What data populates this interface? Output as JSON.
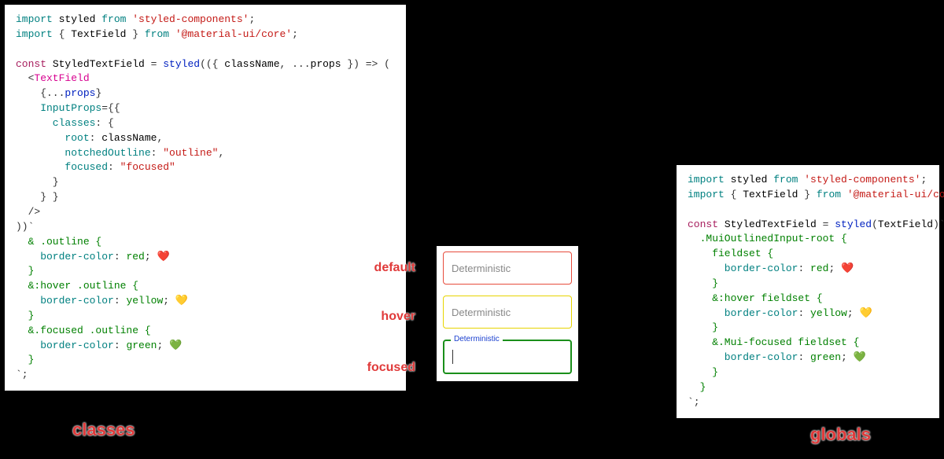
{
  "panel_left": {
    "lines": [
      [
        [
          "kw",
          "import "
        ],
        [
          "id",
          "styled "
        ],
        [
          "kw",
          "from "
        ],
        [
          "str",
          "'styled-components'"
        ],
        [
          "pun",
          ";"
        ]
      ],
      [
        [
          "kw",
          "import "
        ],
        [
          "pun",
          "{ "
        ],
        [
          "id",
          "TextField "
        ],
        [
          "pun",
          "} "
        ],
        [
          "kw",
          "from "
        ],
        [
          "str",
          "'@material-ui/core'"
        ],
        [
          "pun",
          ";"
        ]
      ],
      [
        [
          "",
          ""
        ]
      ],
      [
        [
          "const",
          "const "
        ],
        [
          "id",
          "StyledTextField "
        ],
        [
          "pun",
          "= "
        ],
        [
          "def",
          "styled"
        ],
        [
          "pun",
          "(({ "
        ],
        [
          "id",
          "className"
        ],
        [
          "pun",
          ", ..."
        ],
        [
          "id",
          "props"
        ],
        [
          "pun",
          " }) "
        ],
        [
          "pun",
          "=>"
        ],
        [
          "pun",
          " ("
        ]
      ],
      [
        [
          "pun",
          "  <"
        ],
        [
          "tag",
          "TextField"
        ]
      ],
      [
        [
          "pun",
          "    {..."
        ],
        [
          "prop",
          "props"
        ],
        [
          "pun",
          "}"
        ]
      ],
      [
        [
          "attr",
          "    InputProps"
        ],
        [
          "pun",
          "={{"
        ]
      ],
      [
        [
          "key",
          "      classes"
        ],
        [
          "pun",
          ": {"
        ]
      ],
      [
        [
          "key",
          "        root"
        ],
        [
          "pun",
          ": "
        ],
        [
          "id",
          "className"
        ],
        [
          "pun",
          ","
        ]
      ],
      [
        [
          "key",
          "        notchedOutline"
        ],
        [
          "pun",
          ": "
        ],
        [
          "str",
          "\"outline\""
        ],
        [
          "pun",
          ","
        ]
      ],
      [
        [
          "key",
          "        focused"
        ],
        [
          "pun",
          ": "
        ],
        [
          "str",
          "\"focused\""
        ]
      ],
      [
        [
          "pun",
          "      }"
        ]
      ],
      [
        [
          "pun",
          "    } }"
        ]
      ],
      [
        [
          "pun",
          "  />"
        ]
      ],
      [
        [
          "pun",
          "))`"
        ]
      ],
      [
        [
          "sel",
          "  & .outline {"
        ]
      ],
      [
        [
          "cssprop",
          "    border-color"
        ],
        [
          "pun",
          ": "
        ],
        [
          "cssval",
          "red"
        ],
        [
          "pun",
          "; "
        ],
        [
          "emoji",
          "❤️"
        ]
      ],
      [
        [
          "sel",
          "  }"
        ]
      ],
      [
        [
          "sel",
          "  &:hover .outline {"
        ]
      ],
      [
        [
          "cssprop",
          "    border-color"
        ],
        [
          "pun",
          ": "
        ],
        [
          "cssval",
          "yellow"
        ],
        [
          "pun",
          "; "
        ],
        [
          "emoji",
          "💛"
        ]
      ],
      [
        [
          "sel",
          "  }"
        ]
      ],
      [
        [
          "sel",
          "  &.focused .outline {"
        ]
      ],
      [
        [
          "cssprop",
          "    border-color"
        ],
        [
          "pun",
          ": "
        ],
        [
          "cssval",
          "green"
        ],
        [
          "pun",
          "; "
        ],
        [
          "emoji",
          "💚"
        ]
      ],
      [
        [
          "sel",
          "  }"
        ]
      ],
      [
        [
          "pun",
          "`;"
        ]
      ]
    ]
  },
  "panel_right": {
    "lines": [
      [
        [
          "kw",
          "import "
        ],
        [
          "id",
          "styled "
        ],
        [
          "kw",
          "from "
        ],
        [
          "str",
          "'styled-components'"
        ],
        [
          "pun",
          ";"
        ]
      ],
      [
        [
          "kw",
          "import "
        ],
        [
          "pun",
          "{ "
        ],
        [
          "id",
          "TextField "
        ],
        [
          "pun",
          "} "
        ],
        [
          "kw",
          "from "
        ],
        [
          "str",
          "'@material-ui/core'"
        ],
        [
          "pun",
          ";"
        ]
      ],
      [
        [
          "",
          ""
        ]
      ],
      [
        [
          "const",
          "const "
        ],
        [
          "id",
          "StyledTextField "
        ],
        [
          "pun",
          "= "
        ],
        [
          "def",
          "styled"
        ],
        [
          "pun",
          "("
        ],
        [
          "id",
          "TextField"
        ],
        [
          "pun",
          ")`"
        ]
      ],
      [
        [
          "sel",
          "  .MuiOutlinedInput-root {"
        ]
      ],
      [
        [
          "sel",
          "    fieldset {"
        ]
      ],
      [
        [
          "cssprop",
          "      border-color"
        ],
        [
          "pun",
          ": "
        ],
        [
          "cssval",
          "red"
        ],
        [
          "pun",
          "; "
        ],
        [
          "emoji",
          "❤️"
        ]
      ],
      [
        [
          "sel",
          "    }"
        ]
      ],
      [
        [
          "sel",
          "    &:hover fieldset {"
        ]
      ],
      [
        [
          "cssprop",
          "      border-color"
        ],
        [
          "pun",
          ": "
        ],
        [
          "cssval",
          "yellow"
        ],
        [
          "pun",
          "; "
        ],
        [
          "emoji",
          "💛"
        ]
      ],
      [
        [
          "sel",
          "    }"
        ]
      ],
      [
        [
          "sel",
          "    &.Mui-focused fieldset {"
        ]
      ],
      [
        [
          "cssprop",
          "      border-color"
        ],
        [
          "pun",
          ": "
        ],
        [
          "cssval",
          "green"
        ],
        [
          "pun",
          "; "
        ],
        [
          "emoji",
          "💚"
        ]
      ],
      [
        [
          "sel",
          "    }"
        ]
      ],
      [
        [
          "sel",
          "  }"
        ]
      ],
      [
        [
          "pun",
          "`;"
        ]
      ]
    ]
  },
  "state_labels": {
    "default": "default",
    "hover": "hover",
    "focused": "focused"
  },
  "captions": {
    "classes": "classes",
    "globals": "globals"
  },
  "demo": {
    "placeholder": "Deterministic",
    "floating_label": "Deterministic"
  }
}
